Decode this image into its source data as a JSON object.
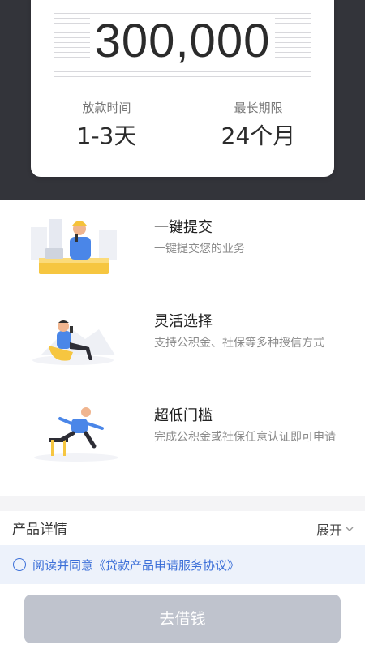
{
  "loan_card": {
    "amount": "300,000",
    "disburse_label": "放款时间",
    "disburse_value": "1-3天",
    "term_label": "最长期限",
    "term_value": "24个月"
  },
  "features": [
    {
      "title": "一键提交",
      "desc": "一键提交您的业务",
      "icon": "worker-at-desk-illustration"
    },
    {
      "title": "灵活选择",
      "desc": "支持公积金、社保等多种授信方式",
      "icon": "person-relaxing-illustration"
    },
    {
      "title": "超低门槛",
      "desc": "完成公积金或社保任意认证即可申请",
      "icon": "person-hurdling-illustration"
    }
  ],
  "details": {
    "title": "产品详情",
    "expand_label": "展开"
  },
  "agreement": {
    "text": "阅读并同意《贷款产品申请服务协议》"
  },
  "apply_button": {
    "label": "去借钱"
  },
  "colors": {
    "dark_bg": "#33343a",
    "accent_blue": "#3b6fd8",
    "button_disabled": "#bfc3cd",
    "agree_bg": "#edf2fb"
  }
}
